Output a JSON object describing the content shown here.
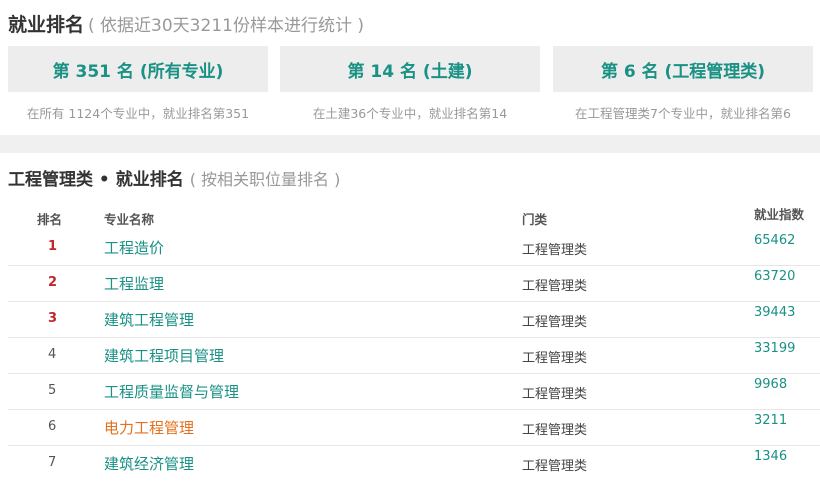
{
  "header": {
    "title": "就业排名",
    "subtitle": "( 依据近30天3211份样本进行统计 )"
  },
  "rank_cards": [
    {
      "label": "第 351 名 (所有专业)",
      "desc": "在所有 1124个专业中，就业排名第351"
    },
    {
      "label": "第 14 名 (土建)",
      "desc": "在土建36个专业中，就业排名第14"
    },
    {
      "label": "第 6 名 (工程管理类)",
      "desc": "在工程管理类7个专业中，就业排名第6"
    }
  ],
  "section": {
    "title": "工程管理类 • 就业排名",
    "subtitle": "( 按相关职位量排名 )"
  },
  "table": {
    "headers": {
      "rank": "排名",
      "name": "专业名称",
      "category": "门类",
      "index": "就业指数"
    },
    "rows": [
      {
        "rank": "1",
        "name": "工程造价",
        "category": "工程管理类",
        "index": "65462"
      },
      {
        "rank": "2",
        "name": "工程监理",
        "category": "工程管理类",
        "index": "63720"
      },
      {
        "rank": "3",
        "name": "建筑工程管理",
        "category": "工程管理类",
        "index": "39443"
      },
      {
        "rank": "4",
        "name": "建筑工程项目管理",
        "category": "工程管理类",
        "index": "33199"
      },
      {
        "rank": "5",
        "name": "工程质量监督与管理",
        "category": "工程管理类",
        "index": "9968"
      },
      {
        "rank": "6",
        "name": "电力工程管理",
        "category": "工程管理类",
        "index": "3211"
      },
      {
        "rank": "7",
        "name": "建筑经济管理",
        "category": "工程管理类",
        "index": "1346"
      }
    ]
  },
  "colors": {
    "accent_teal": "#1a9185",
    "top_rank_red": "#c0272d",
    "highlight_orange": "#e4701e",
    "card_bg": "#ededed"
  }
}
